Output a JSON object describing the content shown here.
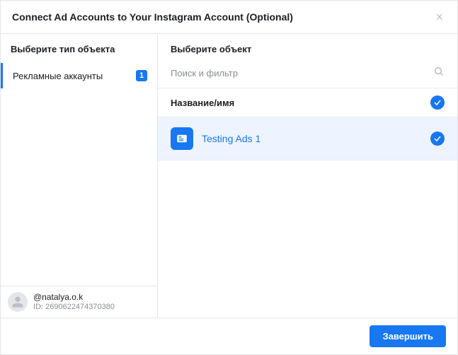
{
  "header": {
    "title": "Connect Ad Accounts to Your Instagram Account (Optional)"
  },
  "sidebar": {
    "title": "Выберите тип объекта",
    "items": [
      {
        "label": "Рекламные аккаунты",
        "count": "1"
      }
    ],
    "user": {
      "handle": "@natalya.o.k",
      "id_label": "ID: 2690622474370380"
    }
  },
  "main": {
    "title": "Выберите объект",
    "search_placeholder": "Поиск и фильтр",
    "column_header": "Название/имя",
    "rows": [
      {
        "name": "Testing Ads 1"
      }
    ]
  },
  "footer": {
    "submit_label": "Завершить"
  }
}
